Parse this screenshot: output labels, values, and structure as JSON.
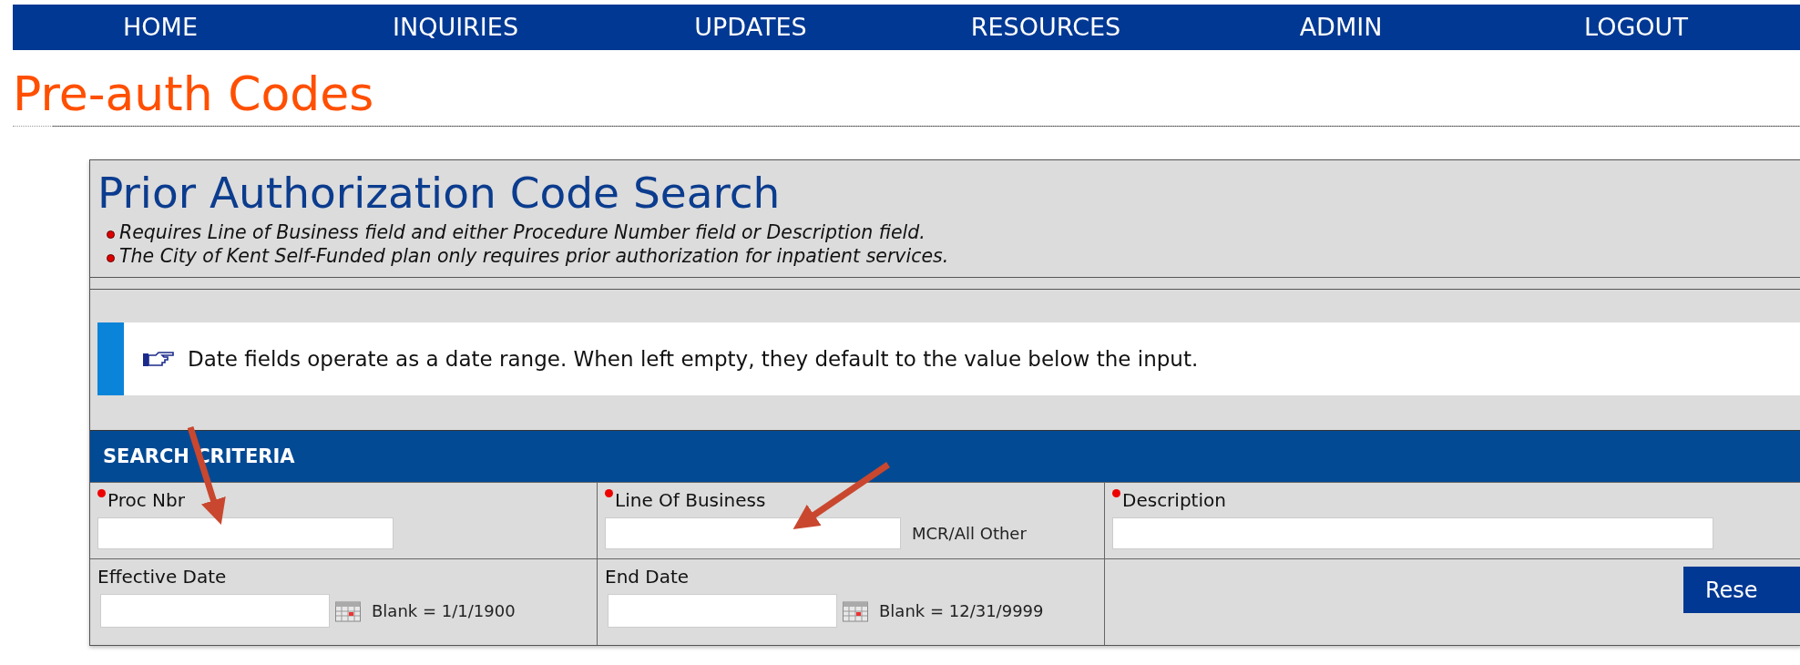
{
  "nav": {
    "items": [
      {
        "label": "HOME"
      },
      {
        "label": "INQUIRIES"
      },
      {
        "label": "UPDATES"
      },
      {
        "label": "RESOURCES"
      },
      {
        "label": "ADMIN"
      },
      {
        "label": "LOGOUT"
      }
    ]
  },
  "page_title": "Pre-auth Codes",
  "panel": {
    "title": "Prior Authorization Code Search",
    "notes": [
      "Requires Line of Business field and either Procedure Number field or Description field.",
      "The City of Kent Self-Funded plan only requires prior authorization for inpatient services."
    ],
    "info": "Date fields operate as a date range. When left empty, they default to the value below the input.",
    "section_title": "SEARCH CRITERIA",
    "rows": [
      [
        {
          "kind": "text",
          "label": "Proc Nbr",
          "required": true
        },
        {
          "kind": "text",
          "label": "Line Of Business",
          "required": true,
          "hint": "MCR/All Other"
        },
        {
          "kind": "text",
          "label": "Description",
          "required": true
        }
      ],
      [
        {
          "kind": "date",
          "label": "Effective Date",
          "required": false,
          "hint": "Blank = 1/1/1900"
        },
        {
          "kind": "date",
          "label": "End Date",
          "required": false,
          "hint": "Blank = 12/31/9999"
        },
        {
          "kind": "button",
          "label": "Rese"
        }
      ]
    ]
  }
}
